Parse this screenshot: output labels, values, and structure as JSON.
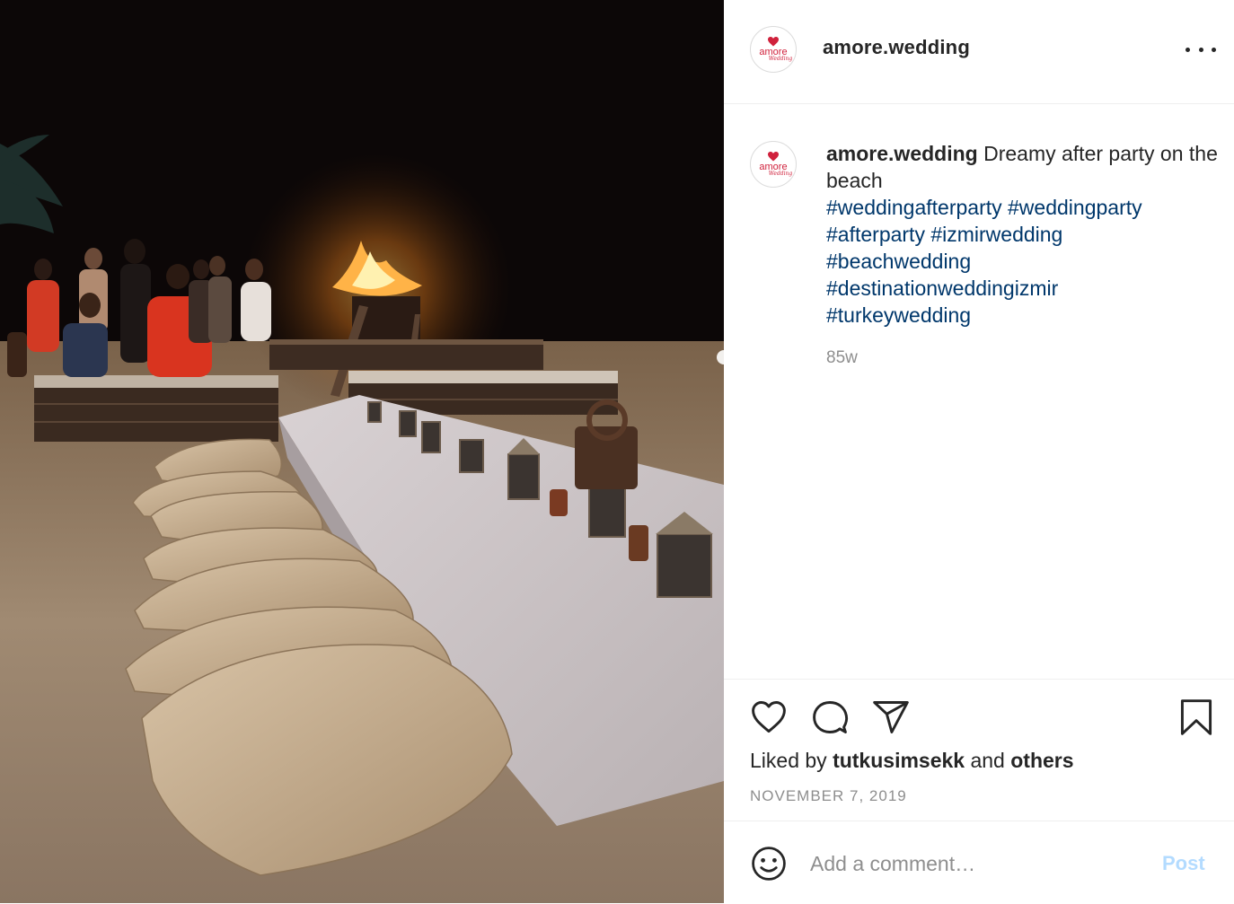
{
  "post": {
    "username": "amore.wedding",
    "avatar_brand": "amore",
    "avatar_script": "Wedding",
    "caption_text": "Dreamy after party on the beach",
    "hashtags": [
      "#weddingafterparty #weddingparty",
      "#afterparty #izmirwedding",
      "#beachwedding",
      "#destinationweddingizmir",
      "#turkeywedding"
    ],
    "time_ago": "85w",
    "liked_prefix": "Liked by",
    "liked_user": "tutkusimsekk",
    "liked_and": "and",
    "liked_others": "others",
    "date": "NOVEMBER 7, 2019"
  },
  "comment": {
    "placeholder": "Add a comment…",
    "post_label": "Post"
  },
  "icons": [
    "heart-icon",
    "comment-icon",
    "share-icon",
    "bookmark-icon",
    "emoji-icon",
    "more-options-icon"
  ],
  "colors": {
    "link": "#00376b",
    "muted": "#8e8e8e",
    "text": "#262626",
    "post_disabled": "#b3dbff",
    "brand_red": "#d0213c"
  }
}
